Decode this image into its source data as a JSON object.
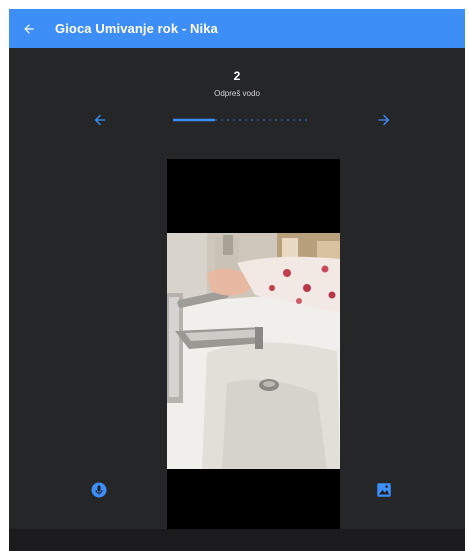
{
  "appbar": {
    "title": "Gioca Umivanje rok - Nika",
    "back_icon": "arrow-left-icon"
  },
  "step": {
    "number": "2",
    "label": "Odpreš vodo"
  },
  "navigation": {
    "prev_icon": "arrow-left-icon",
    "next_icon": "arrow-right-icon",
    "progress": 0.3
  },
  "media": {
    "description_icon": "photo"
  },
  "actions": {
    "mic_icon": "microphone-icon",
    "gallery_icon": "image-icon"
  },
  "colors": {
    "accent": "#3e8ef7",
    "background": "#252628",
    "text": "#ffffff"
  }
}
